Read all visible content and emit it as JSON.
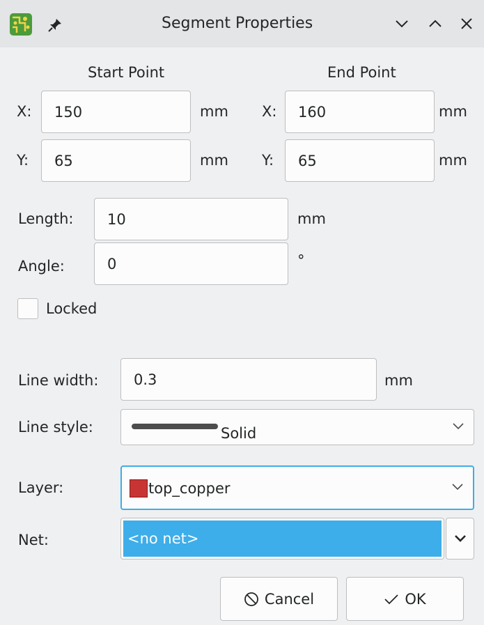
{
  "window": {
    "title": "Segment Properties",
    "app_icon": "pcb-icon",
    "pin_icon": "pin-icon",
    "controls": [
      "minimize-chevron-icon",
      "maximize-chevron-icon",
      "close-icon"
    ]
  },
  "start_point": {
    "heading": "Start Point",
    "x_label": "X:",
    "x_value": "150",
    "y_label": "Y:",
    "y_value": "65",
    "unit": "mm"
  },
  "end_point": {
    "heading": "End Point",
    "x_label": "X:",
    "x_value": "160",
    "y_label": "Y:",
    "y_value": "65",
    "unit": "mm"
  },
  "length": {
    "label": "Length:",
    "value": "10",
    "unit": "mm"
  },
  "angle": {
    "label": "Angle:",
    "value": "0",
    "unit": "°"
  },
  "locked": {
    "label": "Locked",
    "checked": false
  },
  "line_width": {
    "label": "Line width:",
    "value": "0.3",
    "unit": "mm"
  },
  "line_style": {
    "label": "Line style:",
    "value": "Solid"
  },
  "layer": {
    "label": "Layer:",
    "value": "top_copper",
    "swatch_color": "#c83434"
  },
  "net": {
    "label": "Net:",
    "value": "<no net>",
    "highlight_color": "#3daee9"
  },
  "buttons": {
    "cancel": "Cancel",
    "ok": "OK"
  },
  "colors": {
    "accent": "#3daee9",
    "background": "#eff0f1",
    "titlebar": "#e3e5e7"
  }
}
